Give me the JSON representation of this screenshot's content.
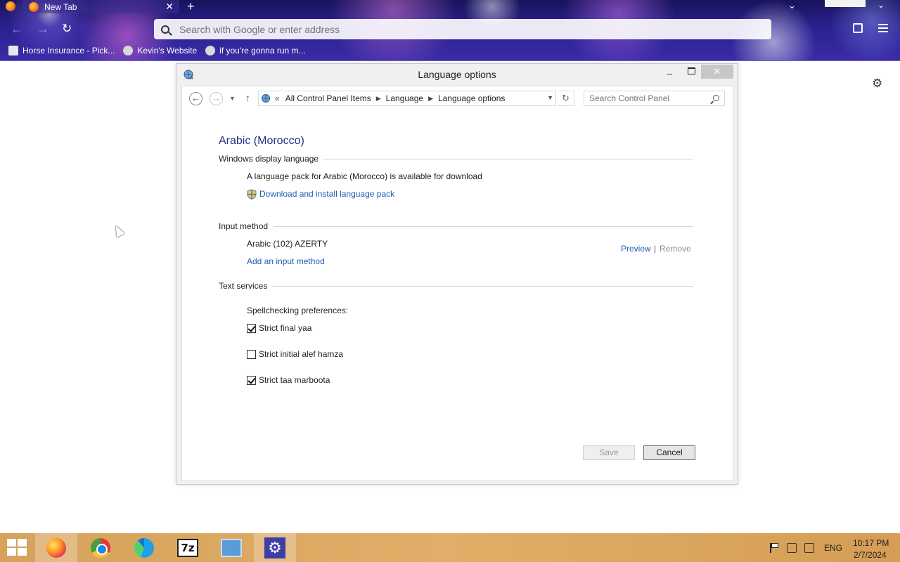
{
  "browser": {
    "tab_title": "New Tab",
    "tab_close": "✕",
    "new_tab": "+",
    "url_placeholder": "Search with Google or enter address",
    "bookmarks": [
      {
        "label": "Horse Insurance - Pick..."
      },
      {
        "label": "Kevin's Website"
      },
      {
        "label": "if you're gonna run m..."
      }
    ]
  },
  "window": {
    "title": "Language options",
    "minimize": "–",
    "close": "✕"
  },
  "address_bar": {
    "lead": "«",
    "crumbs": [
      "All Control Panel Items",
      "Language",
      "Language options"
    ],
    "separator": "›",
    "search_placeholder": "Search Control Panel"
  },
  "content": {
    "language_heading": "Arabic (Morocco)",
    "display_section": {
      "label": "Windows display language",
      "message": "A language pack for Arabic (Morocco) is available for download",
      "download_link": "Download and install language pack"
    },
    "input_section": {
      "label": "Input method",
      "method": "Arabic (102) AZERTY",
      "preview": "Preview",
      "separator": "|",
      "remove": "Remove",
      "add_link": "Add an input method"
    },
    "text_services": {
      "label": "Text services",
      "spellcheck_label": "Spellchecking preferences:",
      "options": [
        {
          "label": "Strict final yaa",
          "checked": true
        },
        {
          "label": "Strict initial alef hamza",
          "checked": false
        },
        {
          "label": "Strict taa marboota",
          "checked": true
        }
      ]
    }
  },
  "buttons": {
    "save": "Save",
    "cancel": "Cancel"
  },
  "taskbar": {
    "language": "ENG",
    "time": "10:17 PM",
    "date": "2/7/2024",
    "apps": [
      "firefox",
      "chrome",
      "edge",
      "7-zip",
      "control-panel",
      "settings"
    ],
    "seven_zip_label": "7z"
  },
  "colors": {
    "link": "#1a5fb4",
    "heading": "#1e3287",
    "taskbar": "#d9a660"
  }
}
